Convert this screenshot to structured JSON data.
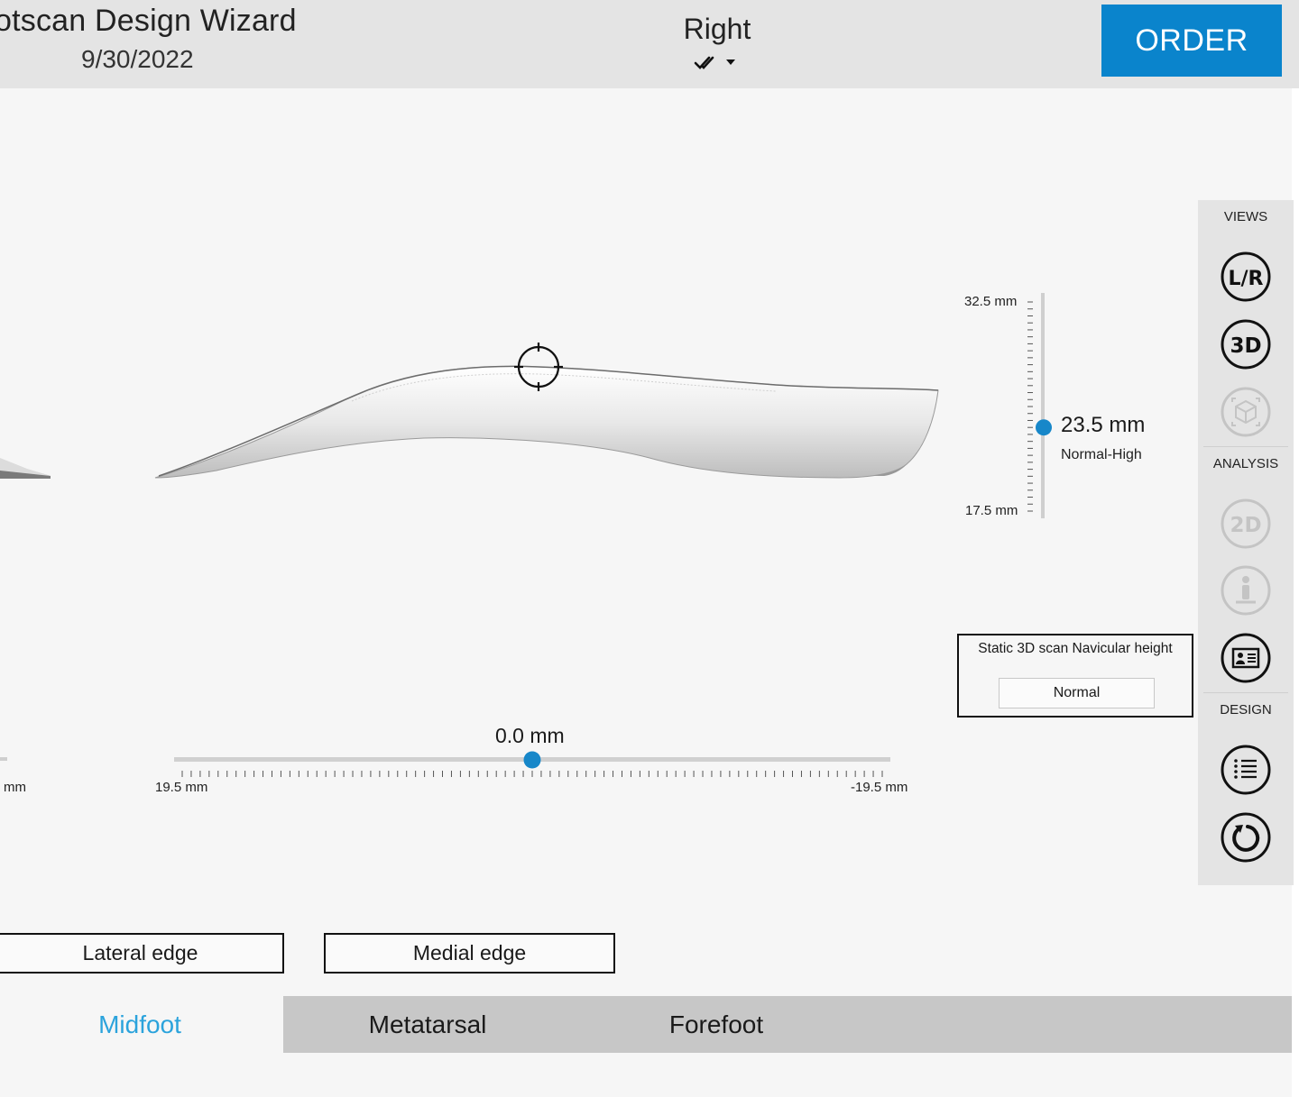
{
  "header": {
    "title": "otscan Design Wizard",
    "date": "9/30/2022",
    "side": "Right",
    "side_icons": [
      "double-check-icon",
      "caret-down-icon"
    ],
    "order_label": "ORDER"
  },
  "colors": {
    "accent": "#0a84cc",
    "active_tab": "#2ba3dc",
    "slider_knob": "#1787c9"
  },
  "height_scale": {
    "max_label": "32.5 mm",
    "min_label": "17.5 mm",
    "value": "23.5 mm",
    "classification": "Normal-High",
    "min": 17.5,
    "max": 32.5,
    "current": 23.5
  },
  "offset_slider": {
    "value": "0.0 mm",
    "left_label": "19.5 mm",
    "right_label": "-19.5 mm",
    "cut_label": "mm",
    "min": -19.5,
    "max": 19.5,
    "current": 0.0
  },
  "navicular": {
    "title": "Static 3D scan Navicular height",
    "value": "Normal"
  },
  "toolbar": {
    "views_label": "VIEWS",
    "analysis_label": "ANALYSIS",
    "design_label": "DESIGN",
    "buttons": [
      {
        "icon": "left-right-view-icon",
        "label": "L/R",
        "enabled": true
      },
      {
        "icon": "3d-view-icon",
        "label": "3D",
        "enabled": true
      },
      {
        "icon": "cube-view-icon",
        "enabled": false
      },
      {
        "icon": "2d-analysis-icon",
        "label": "2D",
        "enabled": false
      },
      {
        "icon": "standing-person-icon",
        "enabled": false
      },
      {
        "icon": "report-card-icon",
        "enabled": true
      },
      {
        "icon": "list-icon",
        "enabled": true
      },
      {
        "icon": "reset-icon",
        "enabled": true
      }
    ]
  },
  "edges": {
    "lateral": "Lateral edge",
    "medial": "Medial edge"
  },
  "tabs": [
    {
      "label": "Midfoot",
      "active": true
    },
    {
      "label": "Metatarsal",
      "active": false
    },
    {
      "label": "Forefoot",
      "active": false
    }
  ]
}
